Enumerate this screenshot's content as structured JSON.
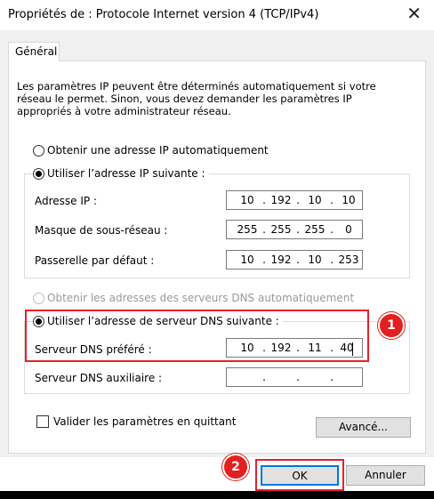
{
  "window": {
    "title": "Propriétés de : Protocole Internet version 4 (TCP/IPv4)",
    "close_glyph": "✕"
  },
  "tab": {
    "label": "Général"
  },
  "intro": "Les paramètres IP peuvent être déterminés automatiquement si votre réseau le permet. Sinon, vous devez demander les paramètres IP appropriés à votre administrateur réseau.",
  "ip_section": {
    "auto_label": "Obtenir une adresse IP automatiquement",
    "manual_label": "Utiliser l’adresse IP suivante :",
    "selected": "manual",
    "fields": [
      {
        "label": "Adresse IP :",
        "octets": [
          "10",
          "192",
          "10",
          "10"
        ]
      },
      {
        "label": "Masque de sous-réseau :",
        "octets": [
          "255",
          "255",
          "255",
          "0"
        ]
      },
      {
        "label": "Passerelle par défaut :",
        "octets": [
          "10",
          "192",
          "10",
          "253"
        ]
      }
    ]
  },
  "dns_section": {
    "auto_label": "Obtenir les adresses des serveurs DNS automatiquement",
    "manual_label": "Utiliser l’adresse de serveur DNS suivante :",
    "selected": "manual",
    "fields": [
      {
        "label": "Serveur DNS préféré :",
        "octets": [
          "10",
          "192",
          "11",
          "40"
        ]
      },
      {
        "label": "Serveur DNS auxiliaire :",
        "octets": [
          "",
          "",
          "",
          ""
        ]
      }
    ]
  },
  "validate_label": "Valider les paramètres en quittant",
  "advanced_button": "Avancé...",
  "ok_button": "OK",
  "cancel_button": "Annuler",
  "annotations": [
    {
      "number": "1"
    },
    {
      "number": "2"
    }
  ],
  "colors": {
    "highlight": "#e8202a",
    "ok_focus": "#0078d7"
  }
}
